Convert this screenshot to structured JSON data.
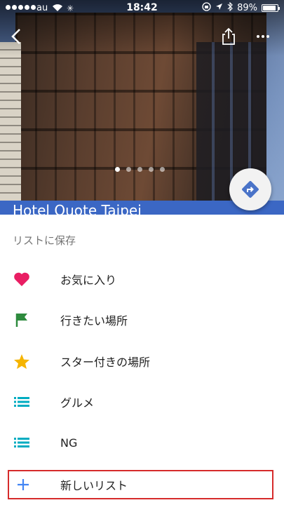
{
  "status_bar": {
    "carrier": "au",
    "time": "18:42",
    "battery_percent": "89%",
    "battery_level": 0.89
  },
  "place": {
    "name": "Hotel Quote Taipei",
    "photo_count": 5,
    "active_photo_index": 0
  },
  "sheet": {
    "title": "リストに保存",
    "items": [
      {
        "label": "お気に入り",
        "icon": "heart-icon",
        "color": "#e91e63"
      },
      {
        "label": "行きたい場所",
        "icon": "flag-icon",
        "color": "#2e8b3e"
      },
      {
        "label": "スター付きの場所",
        "icon": "star-icon",
        "color": "#f5b400"
      },
      {
        "label": "グルメ",
        "icon": "list-icon",
        "color": "#00acc1"
      },
      {
        "label": "NG",
        "icon": "list-icon",
        "color": "#00acc1"
      }
    ],
    "new_list": {
      "label": "新しいリスト",
      "icon": "plus-icon",
      "color": "#4285f4"
    }
  },
  "colors": {
    "highlight_border": "#d62b2b",
    "title_strip": "#3b67c4"
  }
}
